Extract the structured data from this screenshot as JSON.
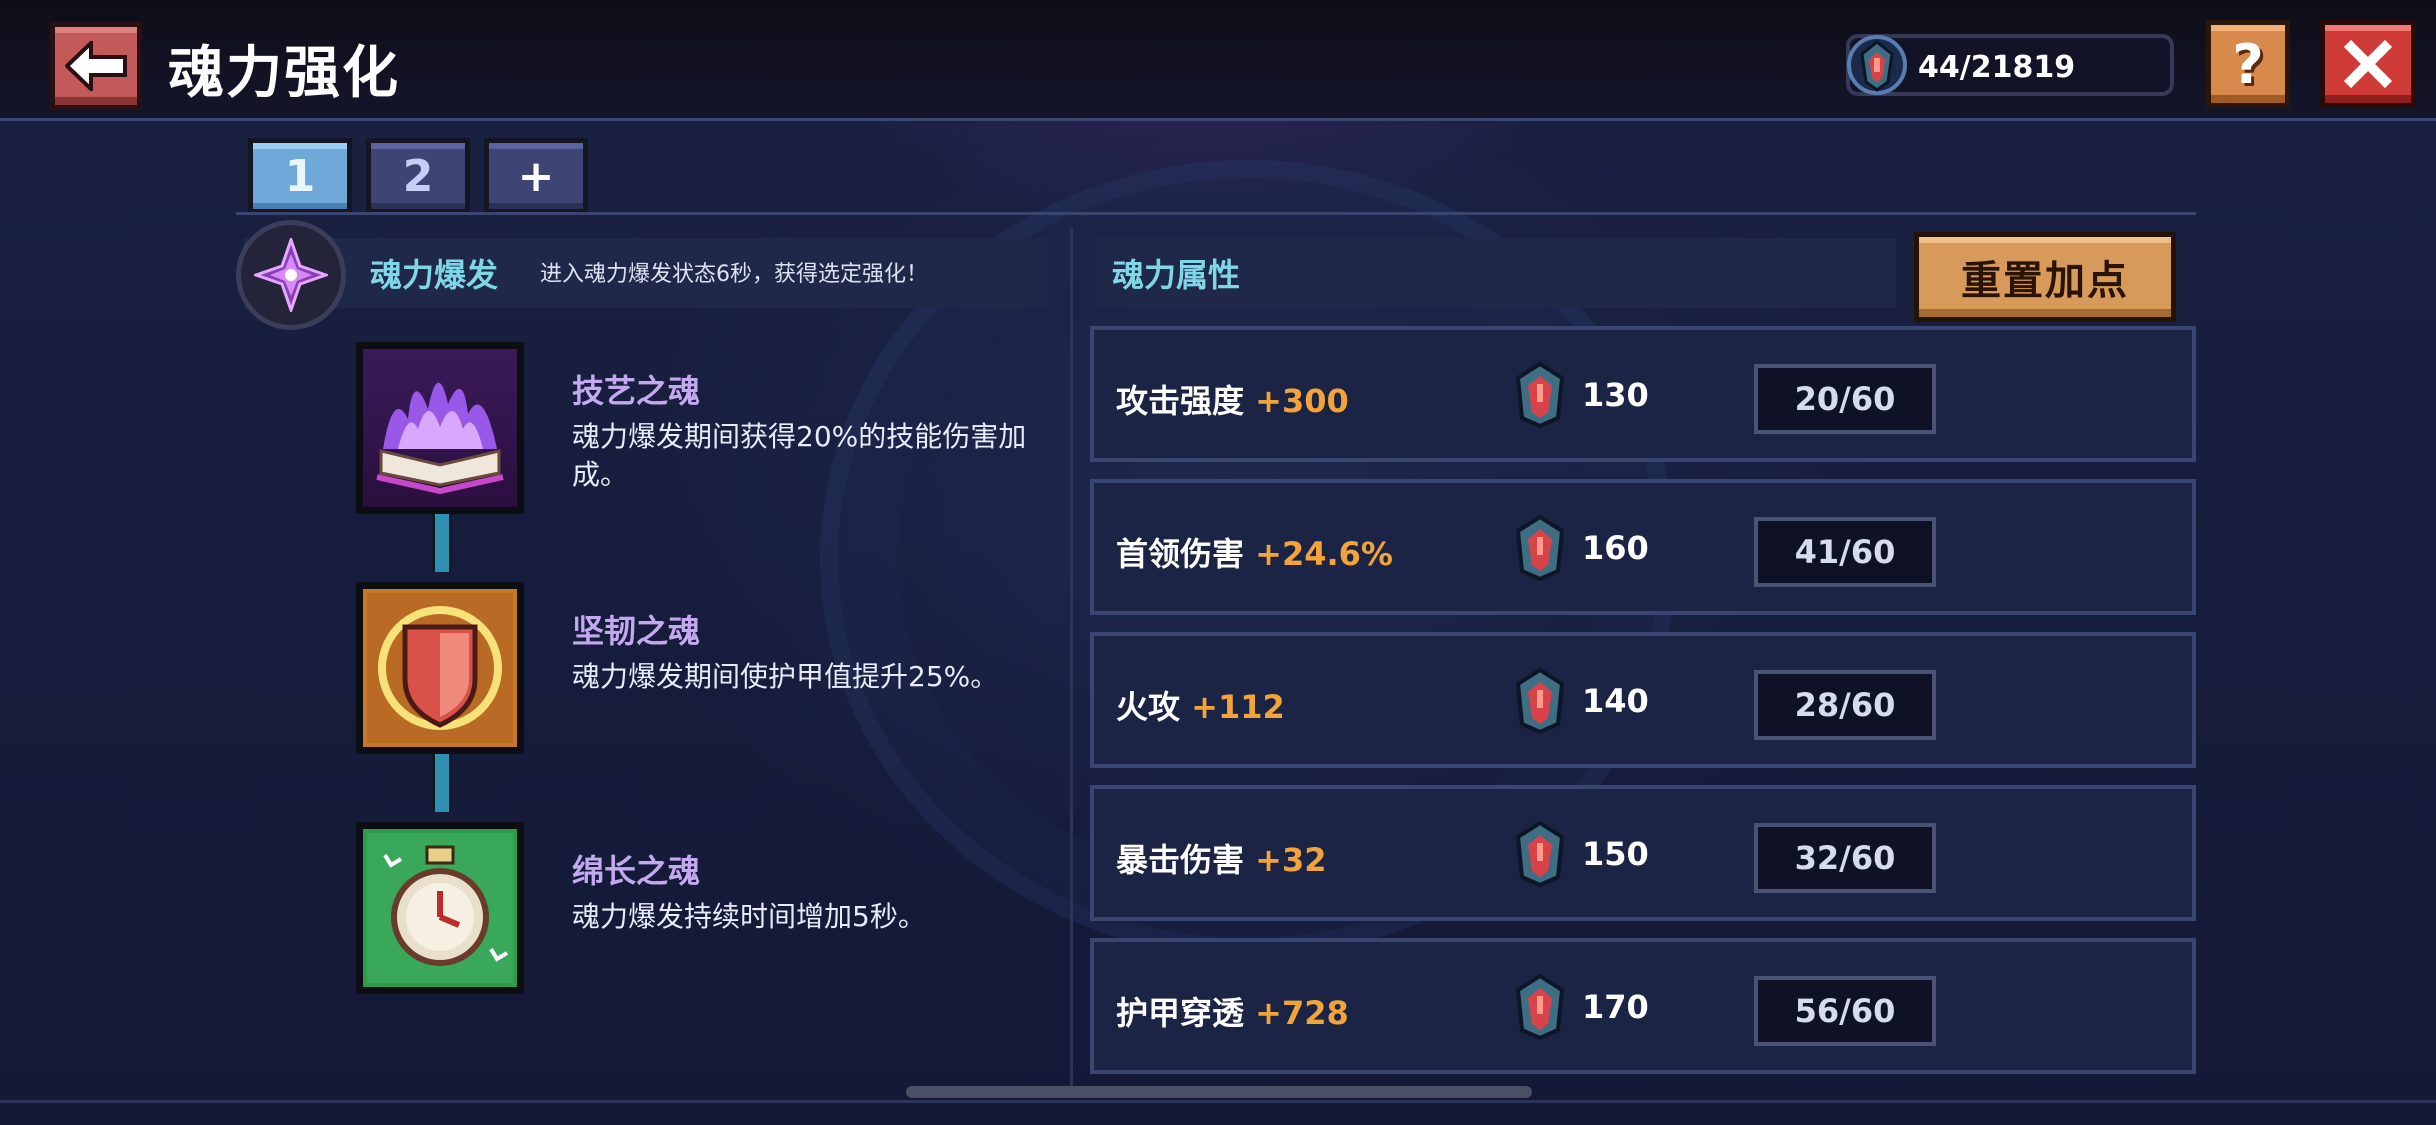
{
  "header": {
    "title": "魂力强化",
    "currency_amount": "44/21819"
  },
  "tabs": [
    {
      "label": "1",
      "active": true
    },
    {
      "label": "2",
      "active": false
    },
    {
      "label": "+",
      "active": false
    }
  ],
  "burst": {
    "name": "魂力爆发",
    "description": "进入魂力爆发状态6秒，获得选定强化！"
  },
  "souls": [
    {
      "title": "技艺之魂",
      "description": "魂力爆发期间获得20%的技能伤害加成。",
      "icon": "purple-flame-book-icon"
    },
    {
      "title": "坚韧之魂",
      "description": "魂力爆发期间使护甲值提升25%。",
      "icon": "shield-icon"
    },
    {
      "title": "绵长之魂",
      "description": "魂力爆发持续时间增加5秒。",
      "icon": "stopwatch-icon"
    }
  ],
  "attributes": {
    "title": "魂力属性",
    "reset_label": "重置加点",
    "rows": [
      {
        "name": "攻击强度",
        "bonus": "+300",
        "cost": "130",
        "level": "20/60"
      },
      {
        "name": "首领伤害",
        "bonus": "+24.6%",
        "cost": "160",
        "level": "41/60"
      },
      {
        "name": "火攻",
        "bonus": "+112",
        "cost": "140",
        "level": "28/60"
      },
      {
        "name": "暴击伤害",
        "bonus": "+32",
        "cost": "150",
        "level": "32/60"
      },
      {
        "name": "护甲穿透",
        "bonus": "+728",
        "cost": "170",
        "level": "56/60"
      }
    ]
  },
  "colors": {
    "accent_cyan": "#7fd6e6",
    "bonus_orange": "#f2a43a",
    "soul_title_purple": "#c4a8f0",
    "tab_active": "#6fa9da",
    "reset_button": "#d79a5a",
    "close_button": "#cf3b36"
  }
}
